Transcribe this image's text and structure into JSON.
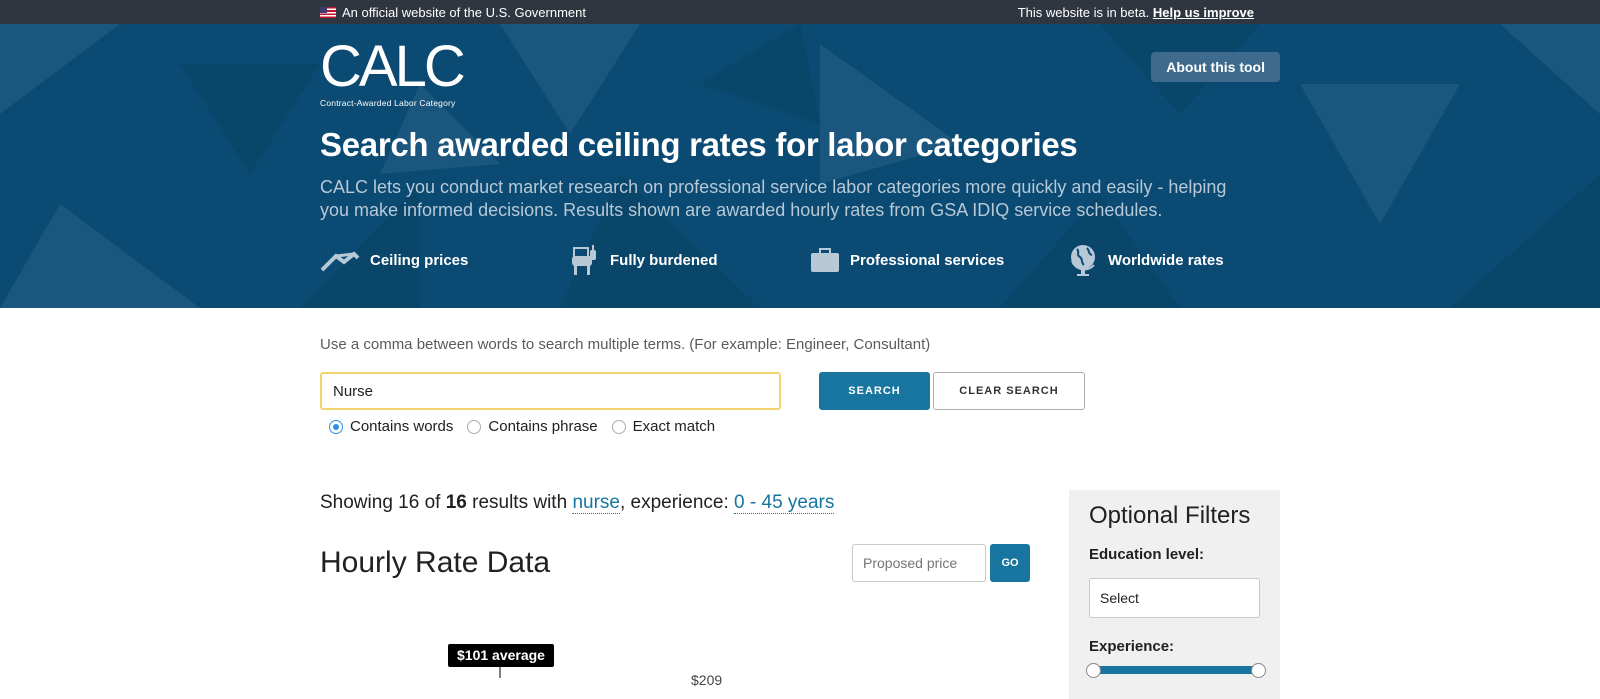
{
  "gov_banner": {
    "official_text": "An official website of the U.S. Government",
    "beta_text": "This website is in beta.",
    "improve_link": "Help us improve"
  },
  "header": {
    "logo_text": "CALC",
    "logo_subtitle": "Contract-Awarded Labor Category",
    "about_button": "About this tool",
    "title": "Search awarded ceiling rates for labor categories",
    "description": "CALC lets you conduct market research on professional service labor categories more quickly and easily - helping you make informed decisions. Results shown are awarded hourly rates from GSA IDIQ service schedules.",
    "features": [
      {
        "label": "Ceiling prices",
        "icon": "roof-icon"
      },
      {
        "label": "Fully burdened",
        "icon": "donkey-icon"
      },
      {
        "label": "Professional services",
        "icon": "briefcase-icon"
      },
      {
        "label": "Worldwide rates",
        "icon": "globe-icon"
      }
    ],
    "colors": {
      "background": "#0b4a72",
      "button": "#3e6b8d"
    }
  },
  "search": {
    "hint": "Use a comma between words to search multiple terms. (For example: Engineer, Consultant)",
    "value": "Nurse",
    "options": [
      {
        "label": "Contains words",
        "checked": true
      },
      {
        "label": "Contains phrase",
        "checked": false
      },
      {
        "label": "Exact match",
        "checked": false
      }
    ],
    "search_button": "SEARCH",
    "clear_button": "CLEAR SEARCH"
  },
  "results": {
    "prefix": "Showing 16 of",
    "total": "16",
    "middle": "results with",
    "term": "nurse",
    "experience_prefix": ", experience:",
    "experience": "0 - 45 years"
  },
  "hourly": {
    "title": "Hourly Rate Data",
    "proposed_placeholder": "Proposed price",
    "go_button": "GO",
    "average_label": "$101 average",
    "max_label": "$209"
  },
  "filters": {
    "title": "Optional Filters",
    "education_label": "Education level:",
    "education_value": "Select",
    "experience_label": "Experience:"
  },
  "colors": {
    "accent": "#17759f",
    "focus_outline": "#f3d36f",
    "banner": "#2f3640"
  }
}
